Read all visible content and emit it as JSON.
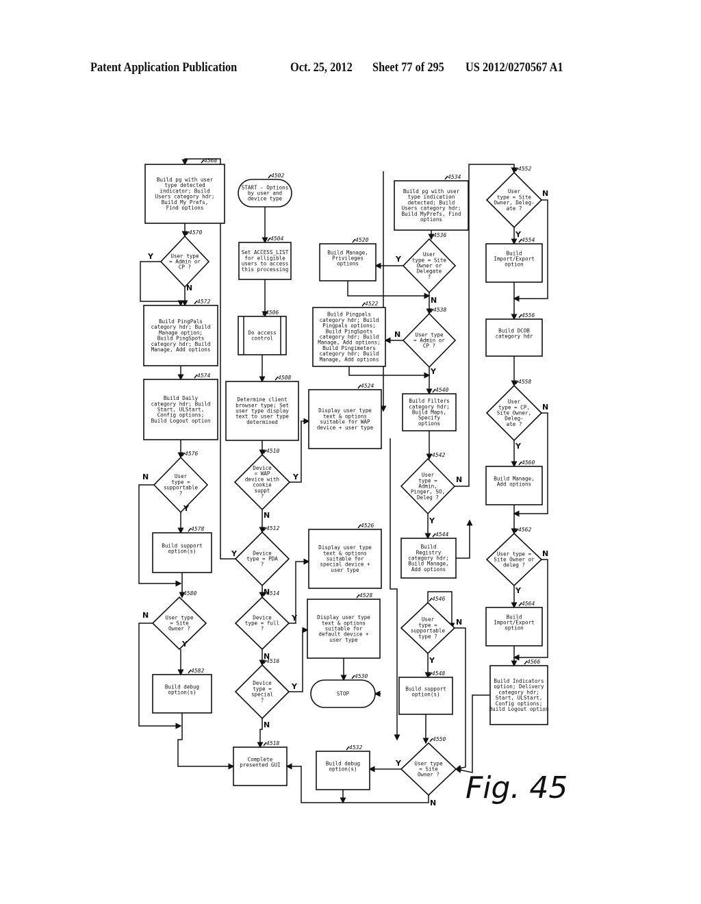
{
  "header": {
    "publication": "Patent Application Publication",
    "date": "Oct. 25, 2012",
    "sheet": "Sheet 77 of 295",
    "number": "US 2012/0270567 A1"
  },
  "figure_label": "Fig. 45",
  "nodes": {
    "n4502": {
      "ref": "4502",
      "type": "terminal",
      "lines": [
        "START - Options",
        "by user and",
        "device type"
      ]
    },
    "n4504": {
      "ref": "4504",
      "type": "process",
      "lines": [
        "Set ACCESS_LIST",
        "for elligible",
        "users to access",
        "this processing"
      ]
    },
    "n4506": {
      "ref": "4506",
      "type": "subroutine",
      "lines": [
        "Do access",
        "control"
      ]
    },
    "n4508": {
      "ref": "4508",
      "type": "process",
      "lines": [
        "Determine client",
        "browser type; Set",
        "user type display",
        "text to user type",
        "determined"
      ]
    },
    "n4510": {
      "ref": "4510",
      "type": "decision",
      "lines": [
        "Device",
        "= WAP",
        "device with",
        "cookie",
        "suppt",
        "?"
      ]
    },
    "n4512": {
      "ref": "4512",
      "type": "decision",
      "lines": [
        "Device",
        "type = PDA",
        "?"
      ]
    },
    "n4514": {
      "ref": "4514",
      "type": "decision",
      "lines": [
        "Device",
        "type = full",
        "?"
      ]
    },
    "n4516": {
      "ref": "4516",
      "type": "decision",
      "lines": [
        "Device",
        "type =",
        "special",
        "?"
      ]
    },
    "n4518": {
      "ref": "4518",
      "type": "process",
      "lines": [
        "Complete",
        "presented GUI"
      ]
    },
    "n4520": {
      "ref": "4520",
      "type": "process",
      "lines": [
        "Build Manage,",
        "Privileges",
        "options"
      ]
    },
    "n4522": {
      "ref": "4522",
      "type": "process",
      "lines": [
        "Build Pingpals",
        "category hdr; Build",
        "Pingpals options;",
        "Build PingSpots",
        "category hdr; Build",
        "Manage, Add options;",
        "Build Pingimeters",
        "category hdr; Build",
        "Manage, Add options"
      ]
    },
    "n4524": {
      "ref": "4524",
      "type": "process",
      "lines": [
        "Display user type",
        "text & options",
        "suitable for WAP",
        "device + user type"
      ]
    },
    "n4526": {
      "ref": "4526",
      "type": "process",
      "lines": [
        "Display user type",
        "text & options",
        "suitable for",
        "special device +",
        "user type"
      ]
    },
    "n4528": {
      "ref": "4528",
      "type": "process",
      "lines": [
        "Display user type",
        "text & options",
        "suitable for",
        "default device +",
        "user type"
      ]
    },
    "n4530": {
      "ref": "4530",
      "type": "terminal",
      "lines": [
        "STOP"
      ]
    },
    "n4532": {
      "ref": "4532",
      "type": "process",
      "lines": [
        "Build debug",
        "option(s)"
      ]
    },
    "n4534": {
      "ref": "4534",
      "type": "process",
      "lines": [
        "Build pg with user",
        "type indication",
        "detected; Build",
        "Users category hdr;",
        "Build MyPrefs, Find",
        "options"
      ]
    },
    "n4536": {
      "ref": "4536",
      "type": "decision",
      "lines": [
        "User",
        "type = Site",
        "Owner or",
        "Delegate",
        "?"
      ]
    },
    "n4538": {
      "ref": "4538",
      "type": "decision",
      "lines": [
        "User type",
        "= Admin or",
        "CP ?"
      ]
    },
    "n4540": {
      "ref": "4540",
      "type": "process",
      "lines": [
        "Build Filters",
        "category hdr;",
        "Build Maps,",
        "Specify",
        "options"
      ]
    },
    "n4542": {
      "ref": "4542",
      "type": "decision",
      "lines": [
        "User",
        "type =",
        "Admin,",
        "Pinger, SO,",
        "Deleg ?"
      ]
    },
    "n4544": {
      "ref": "4544",
      "type": "process",
      "lines": [
        "Build",
        "Registry",
        "category hdr;",
        "Build Manage,",
        "Add options"
      ]
    },
    "n4546": {
      "ref": "4546",
      "type": "decision",
      "lines": [
        "User",
        "type =",
        "supportable",
        "type ?"
      ]
    },
    "n4548": {
      "ref": "4548",
      "type": "process",
      "lines": [
        "Build support",
        "option(s)"
      ]
    },
    "n4550": {
      "ref": "4550",
      "type": "decision",
      "lines": [
        "User type",
        "= Site",
        "Owner ?"
      ]
    },
    "n4552": {
      "ref": "4552",
      "type": "decision",
      "lines": [
        "User",
        "type = Site",
        "Owner, Deleg-",
        "ate ?"
      ]
    },
    "n4554": {
      "ref": "4554",
      "type": "process",
      "lines": [
        "Build",
        "Import/Export",
        "option"
      ]
    },
    "n4556": {
      "ref": "4556",
      "type": "process",
      "lines": [
        "Build DCOB",
        "category hdr"
      ]
    },
    "n4558": {
      "ref": "4558",
      "type": "decision",
      "lines": [
        "User",
        "type = CP,",
        "Site Owner,",
        "Deleg-",
        "ate ?"
      ]
    },
    "n4560": {
      "ref": "4560",
      "type": "process",
      "lines": [
        "Build Manage,",
        "Add options"
      ]
    },
    "n4562": {
      "ref": "4562",
      "type": "decision",
      "lines": [
        "User type =",
        "Site Owner or",
        "deleg ?"
      ]
    },
    "n4564": {
      "ref": "4564",
      "type": "process",
      "lines": [
        "Build",
        "Import/Export",
        "option"
      ]
    },
    "n4566": {
      "ref": "4566",
      "type": "process",
      "lines": [
        "Build Indicators",
        "option; Delivery",
        "category hdr;",
        "Start, ULStart,",
        "Config options;",
        "Build Logout option"
      ]
    },
    "n4568": {
      "ref": "4568",
      "type": "process",
      "lines": [
        "Build pg with user",
        "type detected",
        "indicator; Build",
        "Users category hdr;",
        "Build My Prefs,",
        "Find options"
      ]
    },
    "n4570": {
      "ref": "4570",
      "type": "decision",
      "lines": [
        "User type",
        "= Admin or",
        "CP ?"
      ]
    },
    "n4572": {
      "ref": "4572",
      "type": "process",
      "lines": [
        "Build PingPals",
        "category hdr; Build",
        "Manage option;",
        "Build PingSpots",
        "category hdr; Build",
        "Manage, Add options"
      ]
    },
    "n4574": {
      "ref": "4574",
      "type": "process",
      "lines": [
        "Build Daily",
        "category hdr; Build",
        "Start, ULStart,",
        "Config options;",
        "Build Logout option"
      ]
    },
    "n4576": {
      "ref": "4576",
      "type": "decision",
      "lines": [
        "User",
        "type =",
        "supportable",
        "?"
      ]
    },
    "n4578": {
      "ref": "4578",
      "type": "process",
      "lines": [
        "Build support",
        "option(s)"
      ]
    },
    "n4580": {
      "ref": "4580",
      "type": "decision",
      "lines": [
        "User type",
        "= Site",
        "Owner ?"
      ]
    },
    "n4582": {
      "ref": "4582",
      "type": "process",
      "lines": [
        "Build debug",
        "option(s)"
      ]
    }
  },
  "branch_labels": {
    "yes": "Y",
    "no": "N"
  }
}
